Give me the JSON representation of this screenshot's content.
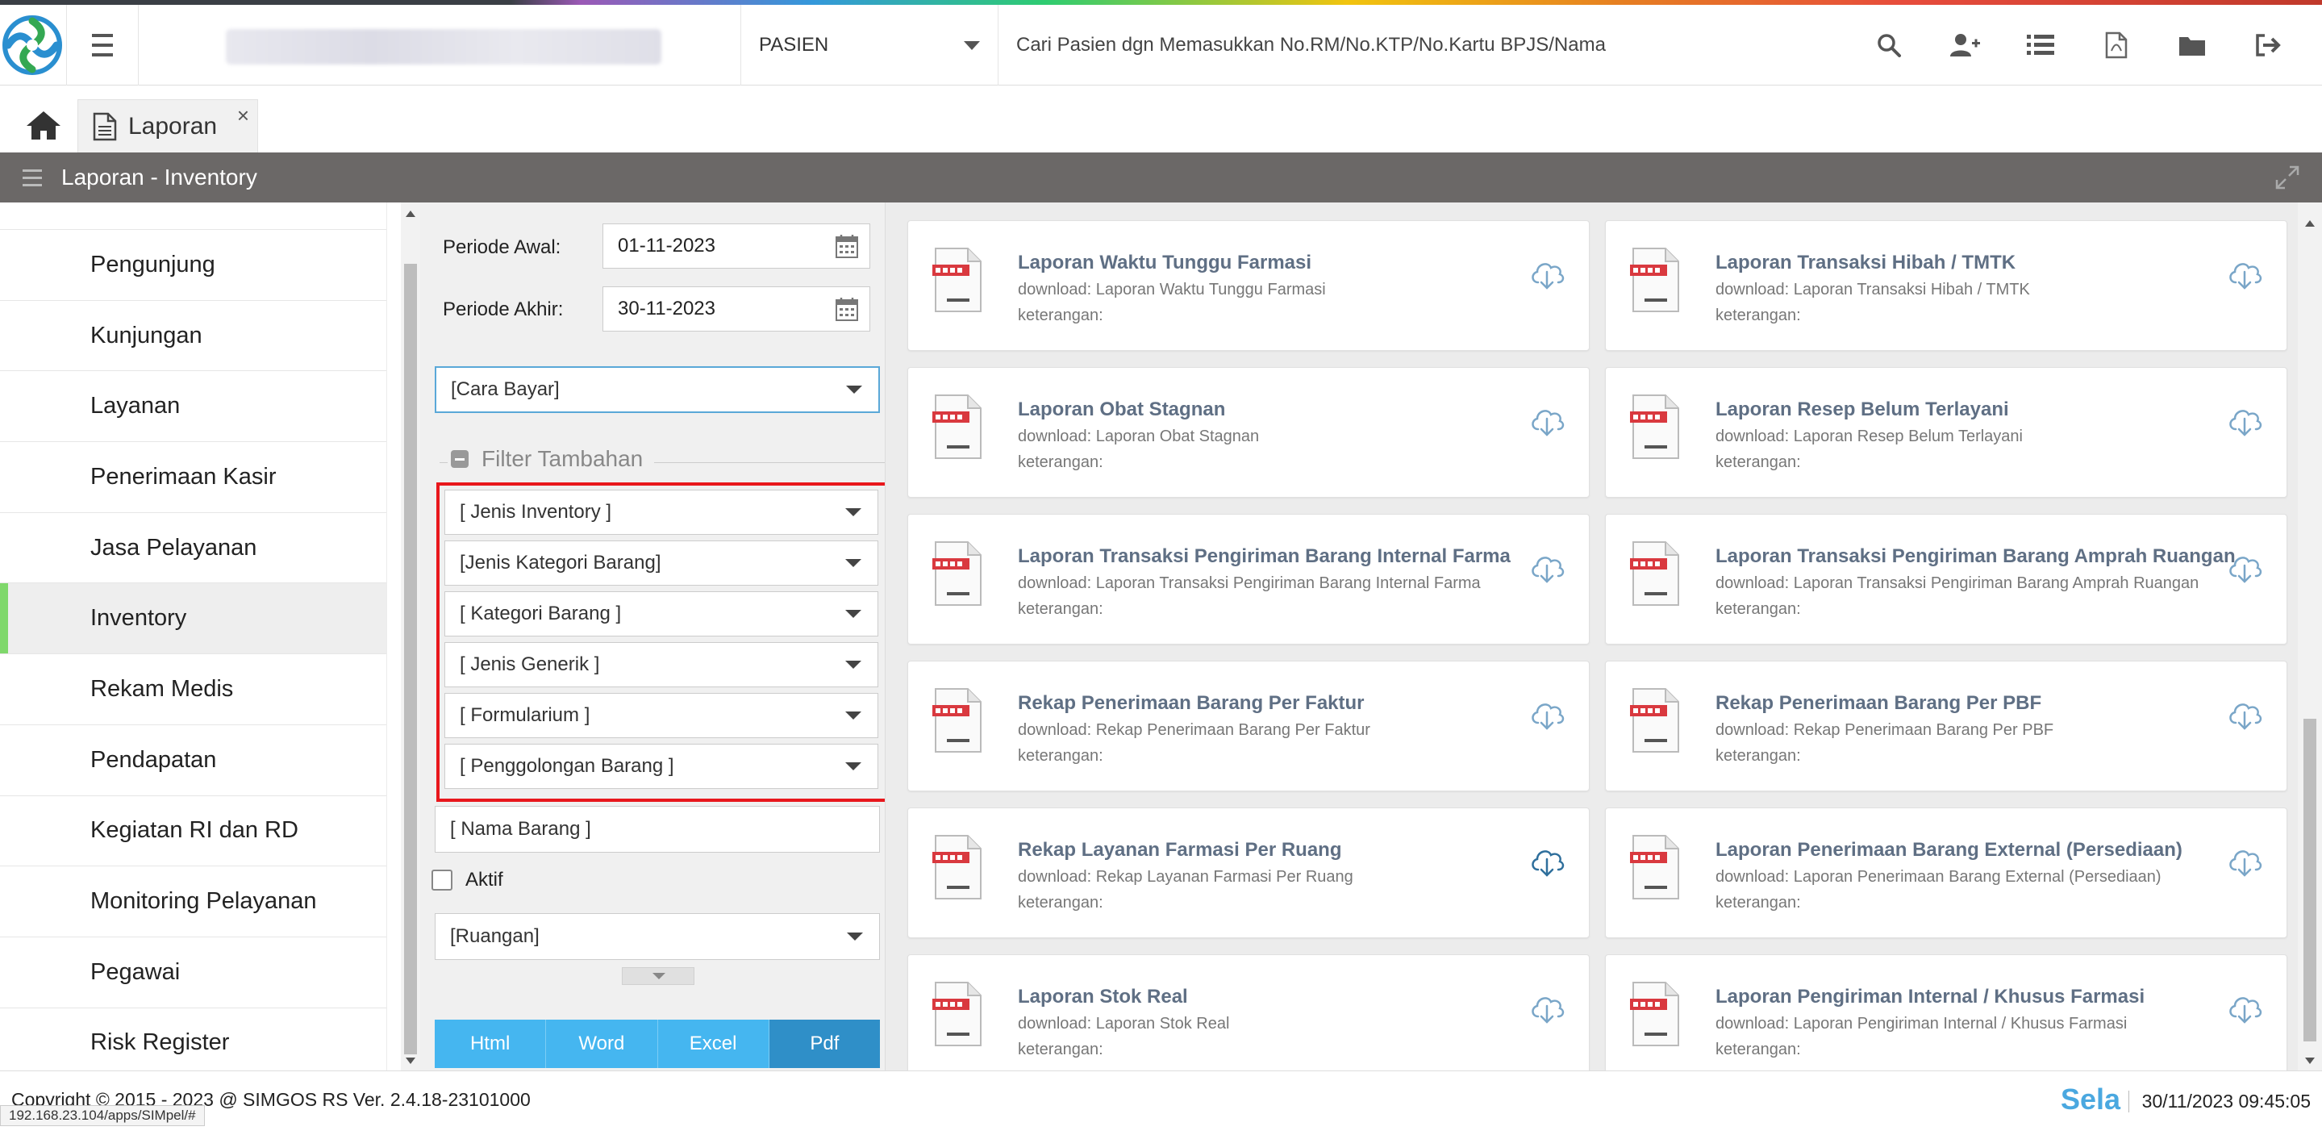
{
  "navbar": {
    "patient_select": "PASIEN",
    "search_placeholder": "Cari Pasien dgn Memasukkan No.RM/No.KTP/No.Kartu BPJS/Nama"
  },
  "tabs": [
    {
      "label": "Laporan",
      "close": "×"
    }
  ],
  "section": {
    "title": "Laporan - Inventory"
  },
  "sidebar": {
    "items": [
      {
        "label": "Pengunjung"
      },
      {
        "label": "Kunjungan"
      },
      {
        "label": "Layanan"
      },
      {
        "label": "Penerimaan Kasir"
      },
      {
        "label": "Jasa Pelayanan"
      },
      {
        "label": "Inventory",
        "active": true
      },
      {
        "label": "Rekam Medis"
      },
      {
        "label": "Pendapatan"
      },
      {
        "label": "Kegiatan RI dan RD"
      },
      {
        "label": "Monitoring Pelayanan"
      },
      {
        "label": "Pegawai"
      },
      {
        "label": "Risk Register"
      }
    ]
  },
  "filter": {
    "periode_awal_label": "Periode Awal:",
    "periode_awal_value": "01-11-2023",
    "periode_akhir_label": "Periode Akhir:",
    "periode_akhir_value": "30-11-2023",
    "cara_bayar": "[Cara Bayar]",
    "filter_tambahan": "Filter Tambahan",
    "extra": [
      "[ Jenis Inventory ]",
      "[Jenis Kategori Barang]",
      "[ Kategori Barang ]",
      "[ Jenis Generik ]",
      "[ Formularium ]",
      "[ Penggolongan Barang ]"
    ],
    "nama_barang": "[ Nama Barang ]",
    "aktif_label": "Aktif",
    "ruangan": "[Ruangan]",
    "export": [
      "Html",
      "Word",
      "Excel",
      "Pdf"
    ]
  },
  "reports": [
    {
      "title": "Laporan Waktu Tunggu Farmasi",
      "download": "download: Laporan Waktu Tunggu Farmasi",
      "note": "keterangan:"
    },
    {
      "title": "Laporan Transaksi Hibah / TMTK",
      "download": "download: Laporan Transaksi Hibah / TMTK",
      "note": "keterangan:"
    },
    {
      "title": "Laporan Obat Stagnan",
      "download": "download: Laporan Obat Stagnan",
      "note": "keterangan:"
    },
    {
      "title": "Laporan Resep Belum Terlayani",
      "download": "download: Laporan Resep Belum Terlayani",
      "note": "keterangan:"
    },
    {
      "title": "Laporan Transaksi Pengiriman Barang Internal Farma",
      "download": "download: Laporan Transaksi Pengiriman Barang Internal Farma",
      "note": "keterangan:"
    },
    {
      "title": "Laporan Transaksi Pengiriman Barang Amprah Ruangan",
      "download": "download: Laporan Transaksi Pengiriman Barang Amprah Ruangan",
      "note": "keterangan:"
    },
    {
      "title": "Rekap Penerimaan Barang Per Faktur",
      "download": "download: Rekap Penerimaan Barang Per Faktur",
      "note": "keterangan:"
    },
    {
      "title": "Rekap Penerimaan Barang Per PBF",
      "download": "download: Rekap Penerimaan Barang Per PBF",
      "note": "keterangan:"
    },
    {
      "title": "Rekap Layanan Farmasi Per Ruang",
      "download": "download: Rekap Layanan Farmasi Per Ruang",
      "note": "keterangan:",
      "hover": true
    },
    {
      "title": "Laporan Penerimaan Barang External (Persediaan)",
      "download": "download: Laporan Penerimaan Barang External (Persediaan)",
      "note": "keterangan:"
    },
    {
      "title": "Laporan Stok Real",
      "download": "download: Laporan Stok Real",
      "note": "keterangan:"
    },
    {
      "title": "Laporan Pengiriman Internal / Khusus Farmasi",
      "download": "download: Laporan Pengiriman Internal / Khusus Farmasi",
      "note": "keterangan:"
    }
  ],
  "footer": {
    "copyright": "Copyright © 2015 - 2023 @ SIMGOS RS Ver. 2.4.18-23101000",
    "status_url": "192.168.23.104/apps/SIMpel/#",
    "brand": "Sela",
    "datetime": "30/11/2023 09:45:05"
  },
  "colors": {
    "accent": "#45b6f0",
    "accent_dark": "#2f8fc8",
    "header_bg": "#6b6867",
    "active_marker": "#7fd86b",
    "highlight_box": "#e8171c"
  }
}
